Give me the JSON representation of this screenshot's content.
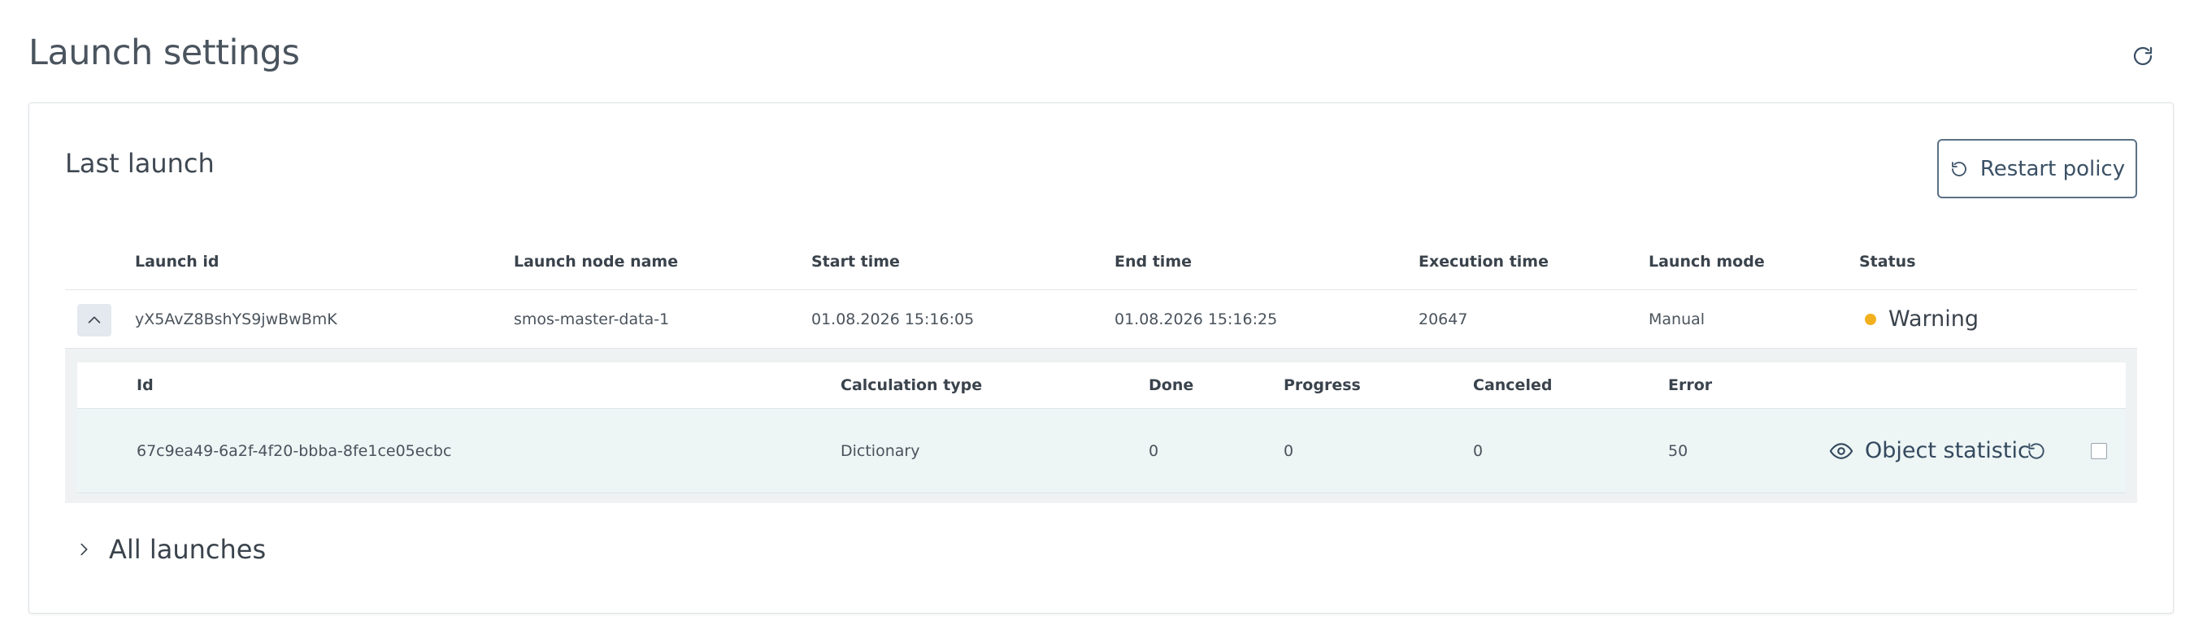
{
  "page": {
    "title": "Launch settings"
  },
  "icons": {
    "refresh": "refresh-icon",
    "restart": "restart-icon",
    "chevron_up": "chevron-up-icon",
    "chevron_right": "chevron-right-icon",
    "eye": "eye-icon",
    "rerun": "rerun-icon"
  },
  "colors": {
    "status_warning": "#f2b01e",
    "accent": "#3b5166"
  },
  "last_launch": {
    "title": "Last launch",
    "restart_label": "Restart policy",
    "columns": [
      "Launch id",
      "Launch node name",
      "Start time",
      "End time",
      "Execution time",
      "Launch mode",
      "Status"
    ],
    "row": {
      "launch_id": "yX5AvZ8BshYS9jwBwBmK",
      "node_name": "smos-master-data-1",
      "start_time": "01.08.2026 15:16:05",
      "end_time": "01.08.2026 15:16:25",
      "execution_time": "20647",
      "launch_mode": "Manual",
      "status": "Warning"
    },
    "details": {
      "columns": [
        "Id",
        "Calculation type",
        "Done",
        "Progress",
        "Canceled",
        "Error"
      ],
      "rows": [
        {
          "id": "67c9ea49-6a2f-4f20-bbba-8fe1ce05ecbc",
          "calculation_type": "Dictionary",
          "done": "0",
          "progress": "0",
          "canceled": "0",
          "error": "50",
          "action_label": "Object statistic"
        }
      ]
    }
  },
  "all_launches": {
    "label": "All launches"
  }
}
